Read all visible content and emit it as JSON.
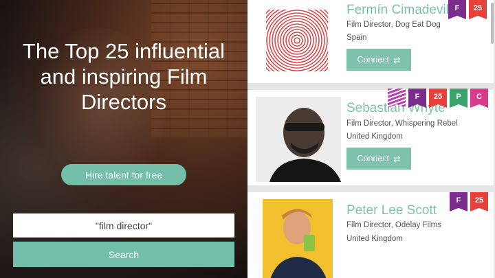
{
  "hero": {
    "title": "The Top 25 influential and inspiring Film Directors",
    "hire_label": "Hire talent for free",
    "search_value": "\"film director\"",
    "search_label": "Search"
  },
  "cards": [
    {
      "name": "Fermín Cimadevilla",
      "role": "Film Director, Dog Eat Dog",
      "location": "Spain",
      "connect": "Connect",
      "badges": [
        {
          "label": "F",
          "color": "#7b2d8e"
        },
        {
          "label": "25",
          "color": "#e8403a"
        }
      ]
    },
    {
      "name": "Sebastian Whyte",
      "role": "Film Director, Whispering Rebel",
      "location": "United Kingdom",
      "connect": "Connect",
      "badges": [
        {
          "label": "",
          "color": "#c03fb0",
          "icon": "stripes-icon"
        },
        {
          "label": "F",
          "color": "#7b2d8e"
        },
        {
          "label": "25",
          "color": "#e8403a"
        },
        {
          "label": "P",
          "color": "#3aa36b"
        },
        {
          "label": "C",
          "color": "#d63c8a"
        }
      ]
    },
    {
      "name": "Peter Lee Scott",
      "role": "Film Director, Odelay Films",
      "location": "United Kingdom",
      "connect": "Connect",
      "badges": [
        {
          "label": "F",
          "color": "#7b2d8e"
        },
        {
          "label": "25",
          "color": "#e8403a"
        }
      ]
    }
  ],
  "colors": {
    "accent": "#72bea8",
    "name": "#7ec1ac"
  }
}
